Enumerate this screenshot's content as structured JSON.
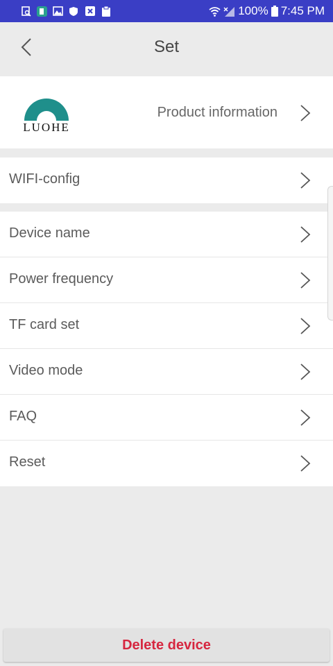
{
  "status_bar": {
    "battery_percent": "100%",
    "time": "7:45 PM",
    "notification_icons": [
      "search-doc-icon",
      "app-icon",
      "image-icon",
      "shield-icon",
      "close-box-icon",
      "clipboard-icon"
    ]
  },
  "header": {
    "title": "Set"
  },
  "product": {
    "logo_text": "LUOHE",
    "label": "Product information"
  },
  "wifi_section": {
    "items": [
      {
        "label": "WIFI-config"
      }
    ]
  },
  "settings_section": {
    "items": [
      {
        "label": "Device name"
      },
      {
        "label": "Power frequency"
      },
      {
        "label": "TF card set"
      },
      {
        "label": "Video mode"
      },
      {
        "label": "FAQ"
      },
      {
        "label": "Reset"
      }
    ]
  },
  "delete_button": {
    "label": "Delete device"
  },
  "colors": {
    "status_bar": "#3a3ec5",
    "logo_teal": "#1f8f8b",
    "delete_red": "#d6263f",
    "background": "#ebebeb"
  }
}
